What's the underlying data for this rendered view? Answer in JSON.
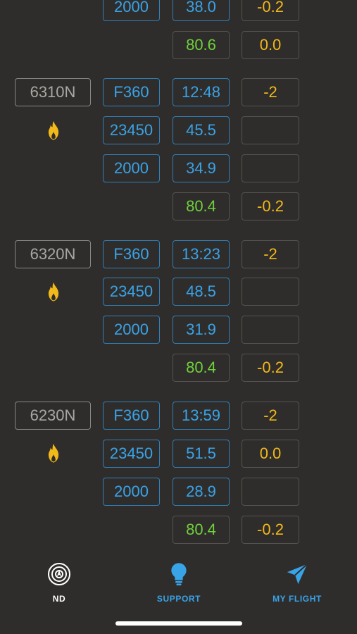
{
  "top_fragment": {
    "alt": "2000",
    "time": "38.0",
    "dev": "-0.2",
    "fuel": "80.6",
    "fuel_dev": "0.0"
  },
  "waypoints": [
    {
      "name": "6310N",
      "fl": "F360",
      "time": "12:48",
      "time_dev": "-2",
      "weight": "23450",
      "temp": "45.5",
      "alt": "2000",
      "value": "34.9",
      "fuel": "80.4",
      "fuel_dev": "-0.2",
      "row2_dev": "",
      "icon": "fire-icon"
    },
    {
      "name": "6320N",
      "fl": "F360",
      "time": "13:23",
      "time_dev": "-2",
      "weight": "23450",
      "temp": "48.5",
      "alt": "2000",
      "value": "31.9",
      "fuel": "80.4",
      "fuel_dev": "-0.2",
      "row2_dev": "",
      "icon": "fire-icon"
    },
    {
      "name": "6230N",
      "fl": "F360",
      "time": "13:59",
      "time_dev": "-2",
      "weight": "23450",
      "temp": "51.5",
      "alt": "2000",
      "value": "28.9",
      "fuel": "80.4",
      "fuel_dev": "-0.2",
      "row2_dev": "0.0",
      "icon": "fire-icon"
    }
  ],
  "tabbar": {
    "nd": {
      "label": "ND",
      "icon": "radar-icon",
      "color": "#ffffff"
    },
    "support": {
      "label": "SUPPORT",
      "icon": "lightbulb-icon",
      "color": "#39a3e8"
    },
    "my_flight": {
      "label": "MY FLIGHT",
      "icon": "paper-plane-icon",
      "color": "#39a3e8"
    }
  },
  "colors": {
    "background": "#2f2d2b",
    "blue": "#39a3e8",
    "green": "#6fd13c",
    "orange": "#f2b91b",
    "grey_text": "#a9a6a3"
  }
}
